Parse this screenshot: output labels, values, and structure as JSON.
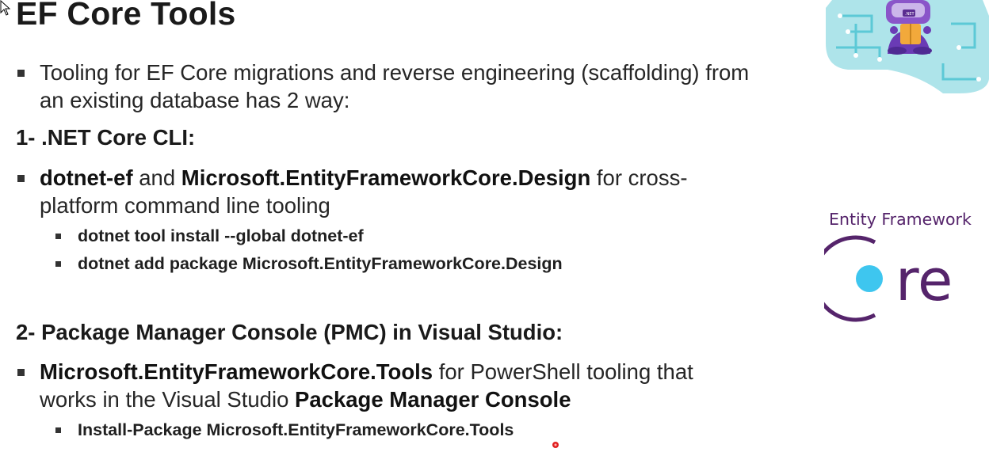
{
  "title": "EF Core Tools",
  "intro": {
    "text": "Tooling for EF Core migrations and reverse engineering (scaffolding) from an existing database has 2 way:"
  },
  "section1": {
    "heading": "1- .NET Core CLI:",
    "bullet": {
      "bold1": "dotnet-ef",
      "mid1": " and ",
      "bold2": "Microsoft.EntityFrameworkCore.Design",
      "rest": " for cross-platform command line tooling"
    },
    "subs": [
      "dotnet tool install --global dotnet-ef",
      "dotnet add package Microsoft.EntityFrameworkCore.Design"
    ]
  },
  "section2": {
    "heading": "2- Package Manager Console (PMC) in Visual Studio:",
    "bullet": {
      "bold1": "Microsoft.EntityFrameworkCore.Tools",
      "mid1": " for PowerShell tooling that works in the Visual Studio ",
      "bold2": "Package Manager Console"
    },
    "subs": [
      "Install-Package Microsoft.EntityFrameworkCore.Tools"
    ]
  },
  "logo": {
    "label": "Entity Framework",
    "word_tail": "re",
    "mascot_badge": ".NET",
    "purple": "#55246b",
    "cyan": "#3ec6ef"
  },
  "icons": {
    "cursor": "mouse-pointer-icon",
    "pointer_dot": "laser-pointer-dot-icon"
  }
}
